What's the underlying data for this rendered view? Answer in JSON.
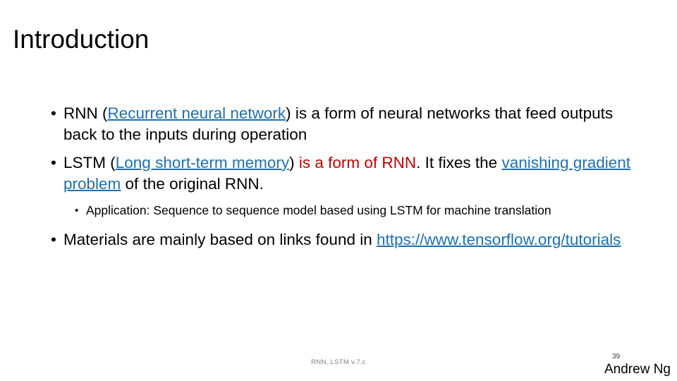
{
  "slide": {
    "title": "Introduction",
    "bullets": [
      {
        "level": 1,
        "marker": "•",
        "segments": [
          {
            "text": "RNN (",
            "style": "plain"
          },
          {
            "text": "Recurrent neural network",
            "style": "link"
          },
          {
            "text": ") is a form of neural networks that feed outputs back to the inputs during operation",
            "style": "plain"
          }
        ]
      },
      {
        "level": 1,
        "marker": "•",
        "segments": [
          {
            "text": "LSTM (",
            "style": "plain"
          },
          {
            "text": "Long short-term memory",
            "style": "link"
          },
          {
            "text": ") ",
            "style": "plain"
          },
          {
            "text": "is a form of RNN",
            "style": "red"
          },
          {
            "text": ". It fixes the ",
            "style": "plain"
          },
          {
            "text": "vanishing gradient problem",
            "style": "link"
          },
          {
            "text": " of the original RNN.",
            "style": "plain"
          }
        ]
      },
      {
        "level": 2,
        "marker": "•",
        "segments": [
          {
            "text": "Application: Sequence to sequence model based using LSTM for machine translation",
            "style": "plain"
          }
        ]
      },
      {
        "level": 1,
        "marker": "•",
        "segments": [
          {
            "text": "Materials are mainly based on links found in ",
            "style": "plain"
          },
          {
            "text": "https://www.tensorflow.org/tutorials",
            "style": "link"
          }
        ]
      }
    ],
    "footer_center": "RNN, LSTM v.7.c",
    "page_number": "39",
    "author": "Andrew Ng"
  },
  "colors": {
    "link": "#1F6FAD",
    "emphasis_red": "#C00000",
    "text": "#000000",
    "footer": "#808080",
    "background": "#FFFFFF"
  }
}
